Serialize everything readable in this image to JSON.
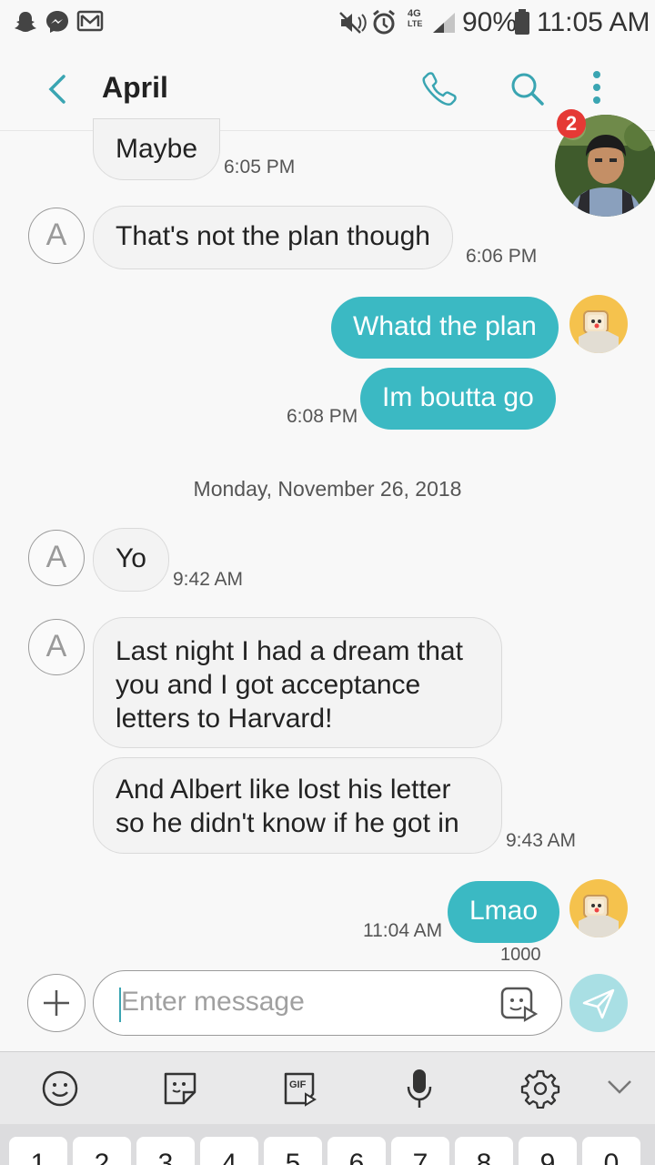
{
  "status_bar": {
    "battery": "90%",
    "time": "11:05 AM",
    "network_type": "4G"
  },
  "header": {
    "contact_name": "April"
  },
  "chat_head": {
    "badge_count": "2"
  },
  "messages": {
    "m1": {
      "text": "Maybe",
      "time": "6:05 PM"
    },
    "m2": {
      "text": "That's not the plan though",
      "time": "6:06 PM",
      "avatar": "A"
    },
    "m3": {
      "text": "Whatd the plan"
    },
    "m4": {
      "text": "Im boutta go",
      "time": "6:08 PM"
    },
    "date_divider": "Monday, November 26, 2018",
    "m5": {
      "text": "Yo",
      "time": "9:42 AM",
      "avatar": "A"
    },
    "m6": {
      "line1": "Last night I had a dream that",
      "line2": "you and I got acceptance",
      "line3": "letters to Harvard!",
      "avatar": "A"
    },
    "m7": {
      "line1": "And Albert like lost his letter",
      "line2": "so he didn't know if he got in",
      "time": "9:43 AM"
    },
    "m8": {
      "text": "Lmao",
      "time": "11:04 AM"
    }
  },
  "composer": {
    "char_remaining": "1000",
    "placeholder": "Enter message"
  },
  "keyboard": {
    "gif_label": "GIF",
    "number_keys": [
      "1",
      "2",
      "3",
      "4",
      "5",
      "6",
      "7",
      "8",
      "9",
      "0"
    ]
  },
  "colors": {
    "accent": "#3bb9c3",
    "send_button": "#a9dfe4",
    "badge": "#e53935"
  }
}
